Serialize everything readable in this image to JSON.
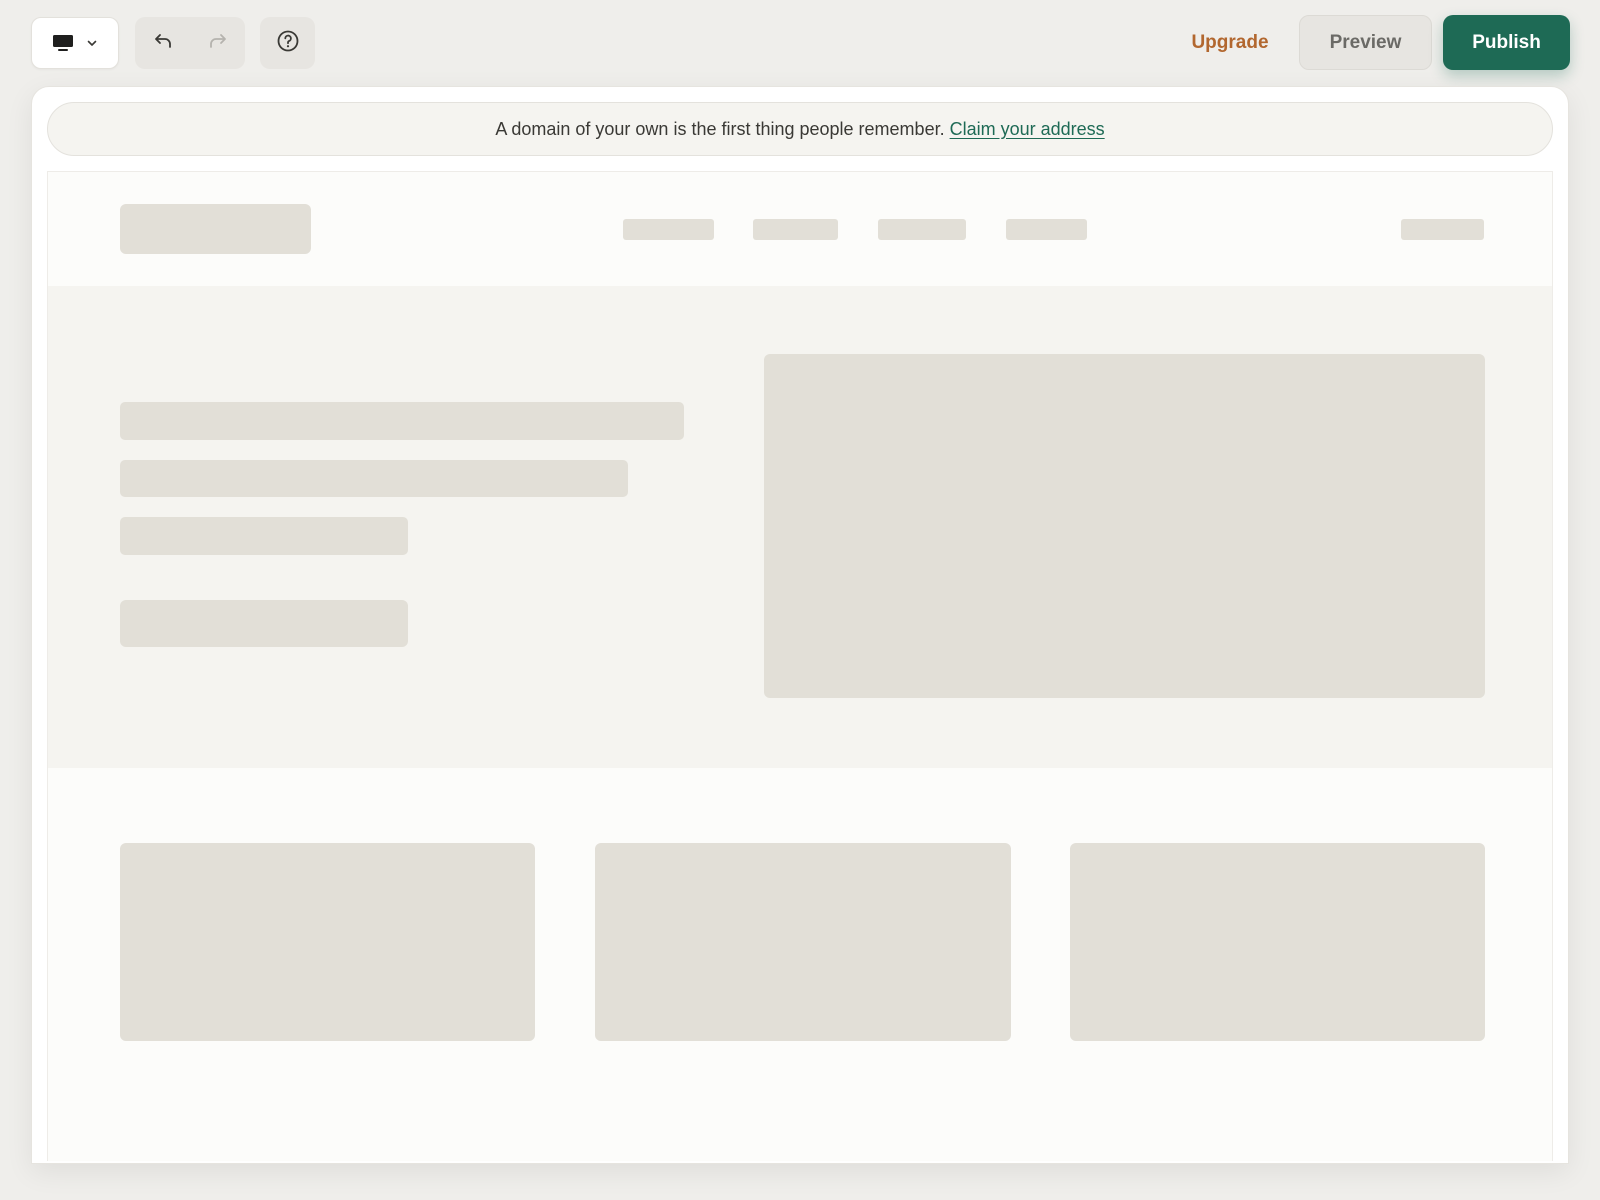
{
  "toolbar": {
    "device_icon": "monitor-icon",
    "device_dropdown_icon": "chevron-down-icon",
    "undo_icon": "undo-icon",
    "redo_icon": "redo-icon",
    "help_icon": "help-circle-icon",
    "upgrade_label": "Upgrade",
    "preview_label": "Preview",
    "publish_label": "Publish"
  },
  "banner": {
    "message": "A domain of your own is the first thing people remember.",
    "link_label": "Claim your address"
  },
  "colors": {
    "accent": "#1e6a55",
    "upgrade": "#b2672f",
    "placeholder": "#e2dfd7",
    "background": "#efeeeb"
  }
}
